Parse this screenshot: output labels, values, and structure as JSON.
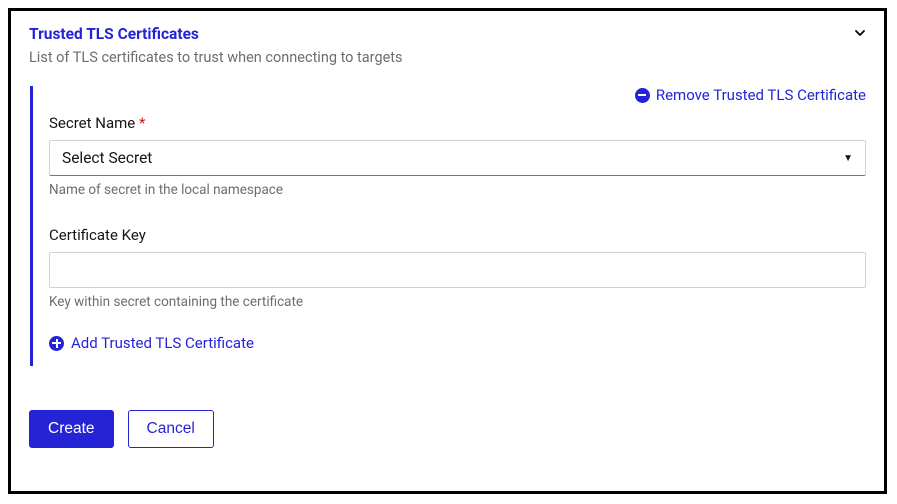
{
  "section": {
    "title": "Trusted TLS Certificates",
    "description": "List of TLS certificates to trust when connecting to targets"
  },
  "certificate": {
    "remove_label": "Remove Trusted TLS Certificate",
    "secret_name": {
      "label": "Secret Name",
      "selected": "Select Secret",
      "hint": "Name of secret in the local namespace"
    },
    "certificate_key": {
      "label": "Certificate Key",
      "value": "",
      "hint": "Key within secret containing the certificate"
    },
    "add_label": "Add Trusted TLS Certificate"
  },
  "buttons": {
    "create": "Create",
    "cancel": "Cancel"
  }
}
